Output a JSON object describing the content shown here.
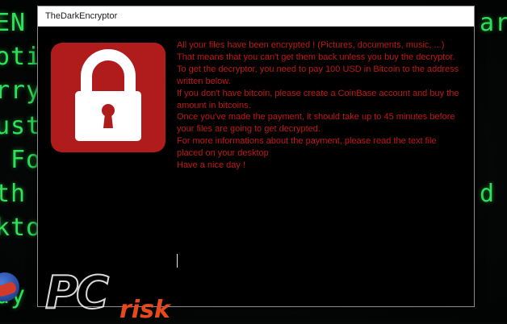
{
  "window": {
    "title": "TheDarkEncryptor"
  },
  "lock_icon": "padlock-icon",
  "message": {
    "lines": [
      "All your files have been encrypted ! (Pictures, documents, music, ...)",
      "That means that you can't get them back unless you buy the decryptor.",
      "To get the decryptor, you need to pay 100 USD in Bitcoin to the address written below.",
      "If you don't have bitcoin, please create a CoinBase account and buy the amount in bitcoins.",
      "Once you've made the payment, it should take up to 45 minutes before your files are going to get decrypted.",
      "For more informations about the payment, please read the text file placed on your desktop",
      "Have a nice day !"
    ]
  },
  "background": {
    "left_lines": [
      "EN",
      "oti",
      "rry",
      "ust",
      " Fo",
      "th",
      "kto",
      "dy"
    ],
    "right_lines": [
      "ar",
      "",
      "",
      "",
      "",
      "",
      "d",
      ""
    ]
  },
  "watermark": {
    "logo_text": "PC",
    "brand_text": "risk"
  },
  "colors": {
    "message_red": "#c01818",
    "lock_tile_red": "#b01c1c",
    "terminal_green": "#2ee05a",
    "watermark_orange": "#e8491c"
  }
}
